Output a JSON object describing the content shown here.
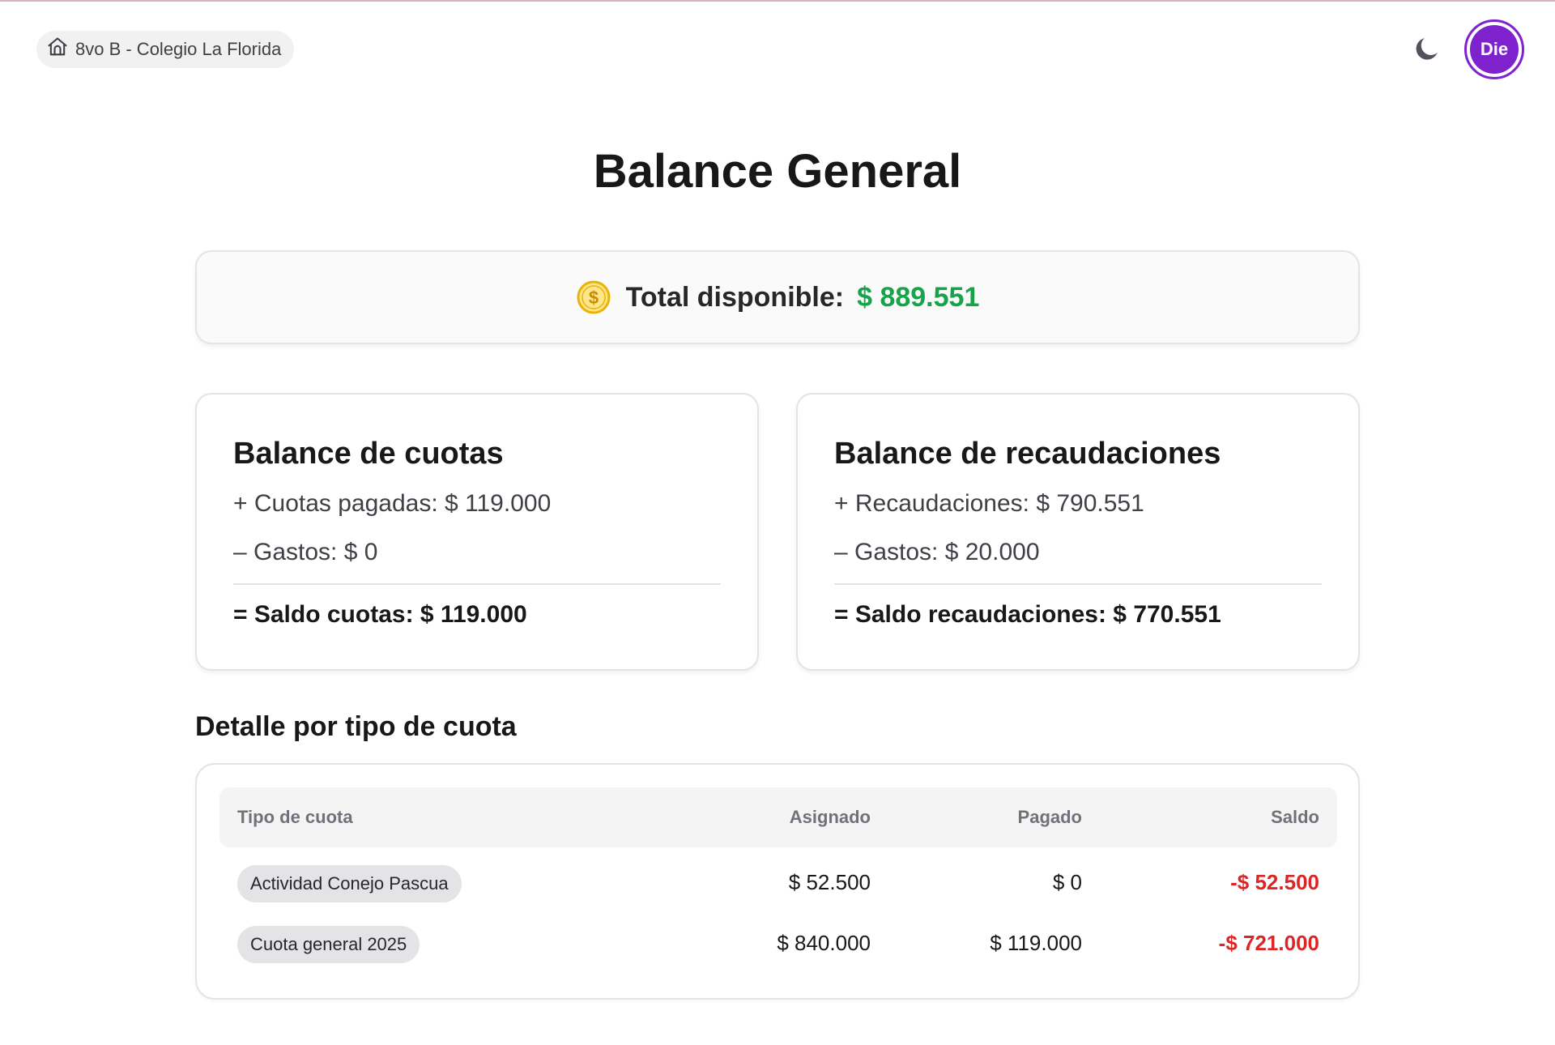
{
  "header": {
    "school": "8vo B - Colegio La Florida",
    "avatar_initials": "Die",
    "theme_icon": "moon-icon"
  },
  "page_title": "Balance General",
  "total": {
    "label": "Total disponible:",
    "value": "$ 889.551",
    "icon": "dollar-coin-icon",
    "value_color": "#16a34a"
  },
  "cuotas": {
    "title": "Balance de cuotas",
    "line1": "+ Cuotas pagadas: $ 119.000",
    "line2": "– Gastos: $ 0",
    "total": "= Saldo cuotas: $ 119.000"
  },
  "recaudaciones": {
    "title": "Balance de recaudaciones",
    "line1": "+ Recaudaciones: $ 790.551",
    "line2": "– Gastos: $ 20.000",
    "total": "= Saldo recaudaciones: $ 770.551"
  },
  "detalle": {
    "title": "Detalle por tipo de cuota",
    "columns": [
      "Tipo de cuota",
      "Asignado",
      "Pagado",
      "Saldo"
    ],
    "rows": [
      {
        "tipo": "Actividad Conejo Pascua",
        "asignado": "$ 52.500",
        "pagado": "$ 0",
        "saldo": "-$ 52.500"
      },
      {
        "tipo": "Cuota general 2025",
        "asignado": "$ 840.000",
        "pagado": "$ 119.000",
        "saldo": "-$ 721.000"
      }
    ],
    "negative_color": "#dc2626"
  },
  "colors": {
    "accent": "#7e22ce",
    "coin": "#eab308"
  }
}
